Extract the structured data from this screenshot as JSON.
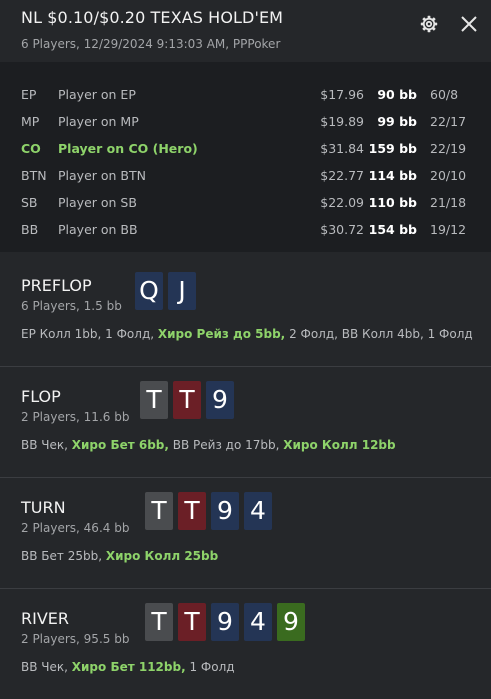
{
  "header": {
    "title": "NL $0.10/$0.20 TEXAS HOLD'EM",
    "subtitle": "6 Players, 12/29/2024 9:13:03 AM, PPPoker"
  },
  "players": [
    {
      "pos": "EP",
      "name": "Player on EP",
      "money": "$17.96",
      "bb": "90 bb",
      "stat": "60/8",
      "hero": false
    },
    {
      "pos": "MP",
      "name": "Player on MP",
      "money": "$19.89",
      "bb": "99 bb",
      "stat": "22/17",
      "hero": false
    },
    {
      "pos": "CO",
      "name": "Player on CO (Hero)",
      "money": "$31.84",
      "bb": "159 bb",
      "stat": "22/19",
      "hero": true
    },
    {
      "pos": "BTN",
      "name": "Player on BTN",
      "money": "$22.77",
      "bb": "114 bb",
      "stat": "20/10",
      "hero": false
    },
    {
      "pos": "SB",
      "name": "Player on SB",
      "money": "$22.09",
      "bb": "110 bb",
      "stat": "21/18",
      "hero": false
    },
    {
      "pos": "BB",
      "name": "Player on BB",
      "money": "$30.72",
      "bb": "154 bb",
      "stat": "19/12",
      "hero": false
    }
  ],
  "streets": [
    {
      "name": "PREFLOP",
      "info": "6 Players, 1.5 bb",
      "cards": [
        {
          "rank": "Q",
          "suit_color": "blue"
        },
        {
          "rank": "J",
          "suit_color": "blue"
        }
      ],
      "actions": [
        {
          "text": "EP Колл 1bb, 1 Фолд, ",
          "hero": false
        },
        {
          "text": "Хиро Рейз до 5bb,",
          "hero": true
        },
        {
          "text": " 2 Фолд, BB Колл 4bb, 1 Фолд",
          "hero": false
        }
      ]
    },
    {
      "name": "FLOP",
      "info": "2 Players, 11.6 bb",
      "cards": [
        {
          "rank": "T",
          "suit_color": "gray"
        },
        {
          "rank": "T",
          "suit_color": "red"
        },
        {
          "rank": "9",
          "suit_color": "blue"
        }
      ],
      "actions": [
        {
          "text": "BB Чек, ",
          "hero": false
        },
        {
          "text": "Хиро Бет 6bb,",
          "hero": true
        },
        {
          "text": " BB Рейз до 17bb, ",
          "hero": false
        },
        {
          "text": "Хиро Колл 12bb",
          "hero": true
        }
      ]
    },
    {
      "name": "TURN",
      "info": "2 Players, 46.4 bb",
      "cards": [
        {
          "rank": "T",
          "suit_color": "gray"
        },
        {
          "rank": "T",
          "suit_color": "red"
        },
        {
          "rank": "9",
          "suit_color": "blue"
        },
        {
          "rank": "4",
          "suit_color": "blue"
        }
      ],
      "actions": [
        {
          "text": "BB Бет 25bb, ",
          "hero": false
        },
        {
          "text": "Хиро Колл 25bb",
          "hero": true
        }
      ]
    },
    {
      "name": "RIVER",
      "info": "2 Players, 95.5 bb",
      "cards": [
        {
          "rank": "T",
          "suit_color": "gray"
        },
        {
          "rank": "T",
          "suit_color": "red"
        },
        {
          "rank": "9",
          "suit_color": "blue"
        },
        {
          "rank": "4",
          "suit_color": "blue"
        },
        {
          "rank": "9",
          "suit_color": "green"
        }
      ],
      "actions": [
        {
          "text": "BB Чек, ",
          "hero": false
        },
        {
          "text": "Хиро Бет 112bb,",
          "hero": true
        },
        {
          "text": " 1 Фолд",
          "hero": false
        }
      ]
    }
  ],
  "icons": {
    "settings": "gear-icon",
    "close": "close-icon"
  },
  "colors": {
    "background": "#25272a",
    "players_panel": "#1c1e21",
    "hero_green": "#8ed36a",
    "card_blue": "#243555",
    "card_gray": "#4a4c4f",
    "card_red": "#6b1f26",
    "card_green": "#3a6b1f"
  }
}
